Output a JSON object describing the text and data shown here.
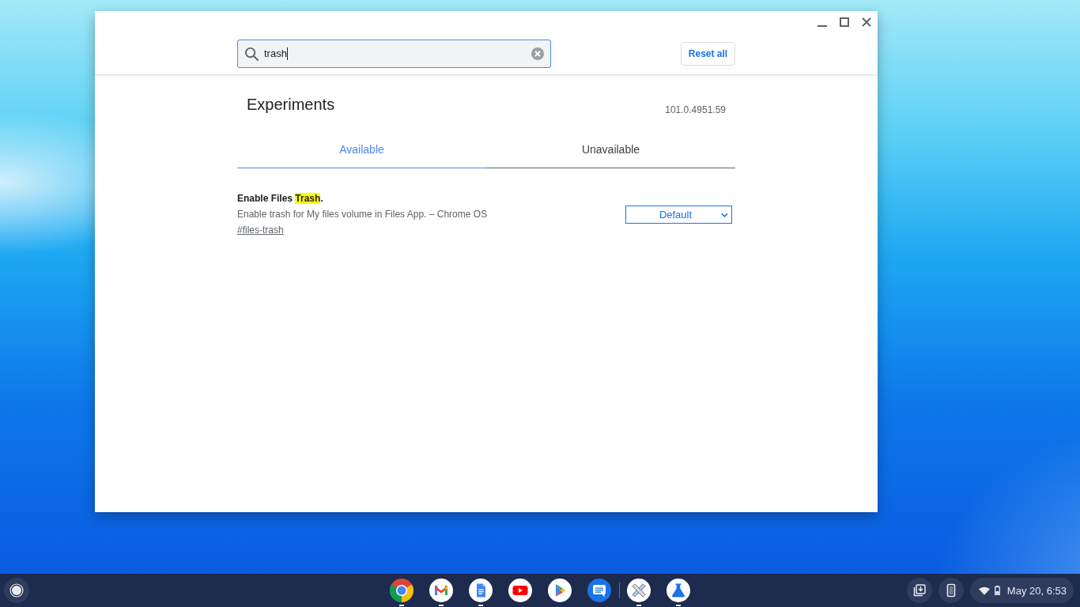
{
  "search": {
    "value": "trash",
    "focused": true
  },
  "reset_button": {
    "label": "Reset all"
  },
  "page": {
    "title": "Experiments",
    "version": "101.0.4951.59"
  },
  "tabs": [
    {
      "label": "Available",
      "selected": true
    },
    {
      "label": "Unavailable",
      "selected": false
    }
  ],
  "experiments": [
    {
      "name": [
        {
          "text": "Enable Files ",
          "highlighted": false
        },
        {
          "text": "Trash",
          "highlighted": true
        },
        {
          "text": ".",
          "highlighted": false
        }
      ],
      "description": "Enable trash for My files volume in Files App. – Chrome OS",
      "link": "#files-trash",
      "value": "Default"
    }
  ],
  "shelf": {
    "app_groups": [
      {
        "apps": [
          {
            "kind": "browser",
            "running": true
          },
          {
            "kind": "mail",
            "running": true
          },
          {
            "kind": "document",
            "running": true
          },
          {
            "kind": "video",
            "running": false
          },
          {
            "kind": "store",
            "running": false
          },
          {
            "kind": "chat",
            "running": false
          }
        ]
      },
      {
        "apps": [
          {
            "kind": "tools",
            "running": true
          },
          {
            "kind": "flask",
            "running": true
          }
        ]
      }
    ],
    "clock": "May 20, 6:53"
  }
}
